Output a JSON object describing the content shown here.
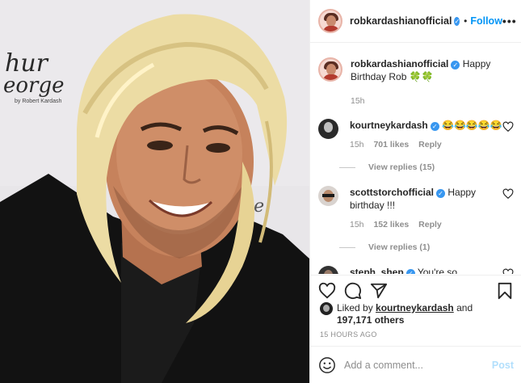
{
  "photo": {
    "backdrop_line1": "hur",
    "backdrop_line2": "eorge",
    "backdrop_byline": "by Robert Kardash",
    "backdrop_line3": "ge"
  },
  "header": {
    "username": "robkardashianofficial",
    "separator": "•",
    "follow_label": "Follow",
    "more_label": "•••"
  },
  "caption": {
    "username": "robkardashianofficial",
    "text": "Happy Birthday Rob 🍀🍀",
    "age": "15h"
  },
  "comments": [
    {
      "username": "kourtneykardash",
      "text": "😂😂😂😂😂",
      "age": "15h",
      "likes": "701 likes",
      "reply_label": "Reply",
      "view_replies": "View replies (15)"
    },
    {
      "username": "scottstorchofficial",
      "text": "Happy birthday !!!",
      "age": "15h",
      "likes": "152 likes",
      "reply_label": "Reply",
      "view_replies": "View replies (1)"
    },
    {
      "username": "steph_shep",
      "text": "You're so"
    }
  ],
  "likes": {
    "prefix": "Liked by",
    "user": "kourtneykardash",
    "and": "and",
    "others": "197,171 others"
  },
  "timestamp": "15 HOURS AGO",
  "comment_box": {
    "placeholder": "Add a comment...",
    "post_label": "Post"
  },
  "icons": [
    "emoji-icon",
    "heart-icon",
    "comment-icon",
    "share-icon",
    "bookmark-icon",
    "verified-icon",
    "more-icon"
  ]
}
